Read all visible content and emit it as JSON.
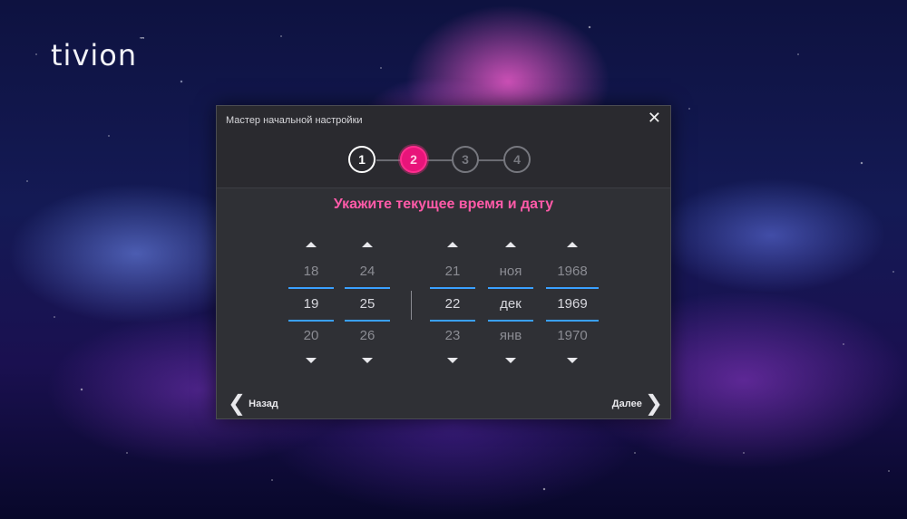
{
  "brand": {
    "logo_text": "tivion",
    "tm": "™"
  },
  "wizard": {
    "title": "Мастер начальной настройки",
    "close_glyph": "✕",
    "steps": [
      {
        "label": "1",
        "state": "done"
      },
      {
        "label": "2",
        "state": "active"
      },
      {
        "label": "3",
        "state": "pending"
      },
      {
        "label": "4",
        "state": "pending"
      }
    ],
    "headline": "Укажите текущее время и дату",
    "pickers": {
      "hour": {
        "prev": "18",
        "current": "19",
        "next": "20"
      },
      "minute": {
        "prev": "24",
        "current": "25",
        "next": "26"
      },
      "day": {
        "prev": "21",
        "current": "22",
        "next": "23"
      },
      "month": {
        "prev": "ноя",
        "current": "дек",
        "next": "янв"
      },
      "year": {
        "prev": "1968",
        "current": "1969",
        "next": "1970"
      }
    },
    "back_label": "Назад",
    "next_label": "Далее",
    "back_glyph": "❮",
    "next_glyph": "❯"
  },
  "colors": {
    "accent_pink": "#e8147a",
    "headline_pink": "#ff5aa8",
    "selection_blue": "#3aa0ff"
  }
}
